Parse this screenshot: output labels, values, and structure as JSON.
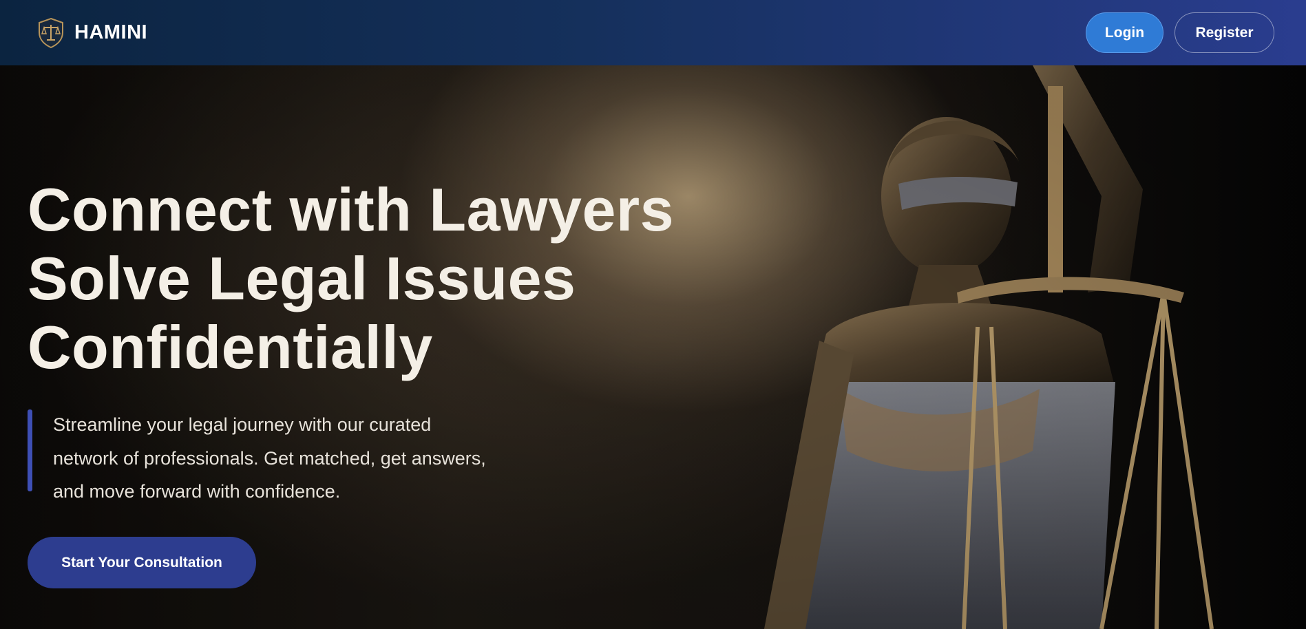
{
  "navbar": {
    "brand_name": "HAMINI",
    "brand_icon": "scales-shield-icon",
    "login_label": "Login",
    "register_label": "Register"
  },
  "hero": {
    "title_lines": [
      "Connect with Lawyers",
      "Solve Legal Issues",
      "Confidentially"
    ],
    "description_lines": [
      "Streamline your legal journey with our curated",
      "network of professionals. Get matched, get answers,",
      "and move forward with confidence."
    ],
    "cta_label": "Start Your Consultation",
    "image": "lady-justice-statue"
  },
  "colors": {
    "navbar_start": "#0b2440",
    "navbar_end": "#2a3d8f",
    "login_button": "#2f7bd6",
    "cta_button": "#2d3d8f",
    "accent_bar": "#3e4fb5"
  }
}
